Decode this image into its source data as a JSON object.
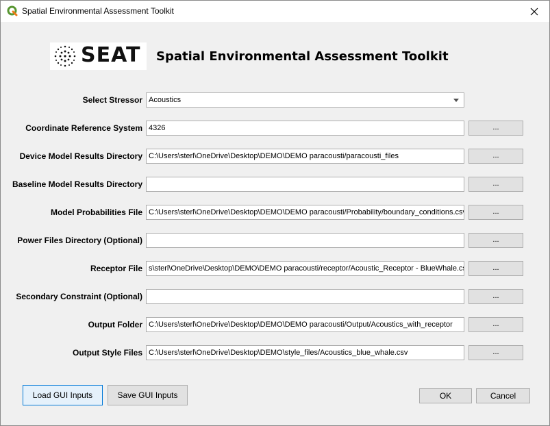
{
  "window": {
    "title": "Spatial Environmental Assessment Toolkit"
  },
  "header": {
    "logo_text": "SEAT",
    "heading": "Spatial Environmental Assessment Toolkit"
  },
  "form": {
    "browse_label": "...",
    "stressor": {
      "label": "Select Stressor",
      "value": "Acoustics"
    },
    "crs": {
      "label": "Coordinate Reference System",
      "value": "4326"
    },
    "device_dir": {
      "label": "Device Model Results Directory",
      "value": "C:\\Users\\sterl\\OneDrive\\Desktop\\DEMO\\DEMO paracousti/paracousti_files"
    },
    "baseline_dir": {
      "label": "Baseline Model Results Directory",
      "value": ""
    },
    "prob_file": {
      "label": "Model Probabilities File",
      "value": "C:\\Users\\sterl\\OneDrive\\Desktop\\DEMO\\DEMO paracousti/Probability/boundary_conditions.csv"
    },
    "power_dir": {
      "label": "Power Files Directory (Optional)",
      "value": ""
    },
    "receptor_file": {
      "label": "Receptor File",
      "value": "s\\sterl\\OneDrive\\Desktop\\DEMO\\DEMO paracousti/receptor/Acoustic_Receptor - BlueWhale.csv"
    },
    "secondary": {
      "label": "Secondary Constraint (Optional)",
      "value": ""
    },
    "output_folder": {
      "label": "Output Folder",
      "value": "C:\\Users\\sterl\\OneDrive\\Desktop\\DEMO\\DEMO paracousti/Output/Acoustics_with_receptor"
    },
    "style_files": {
      "label": "Output Style Files",
      "value": "C:\\Users\\sterl\\OneDrive\\Desktop\\DEMO\\style_files/Acoustics_blue_whale.csv"
    }
  },
  "buttons": {
    "load": "Load GUI Inputs",
    "save": "Save GUI Inputs",
    "ok": "OK",
    "cancel": "Cancel"
  },
  "icons": {
    "app": "qgis-icon",
    "close": "close-icon",
    "logo": "seat-dots-logo-icon",
    "dropdown": "chevron-down-icon"
  },
  "colors": {
    "qgis_green": "#589632",
    "primary_border": "#0078d7"
  }
}
